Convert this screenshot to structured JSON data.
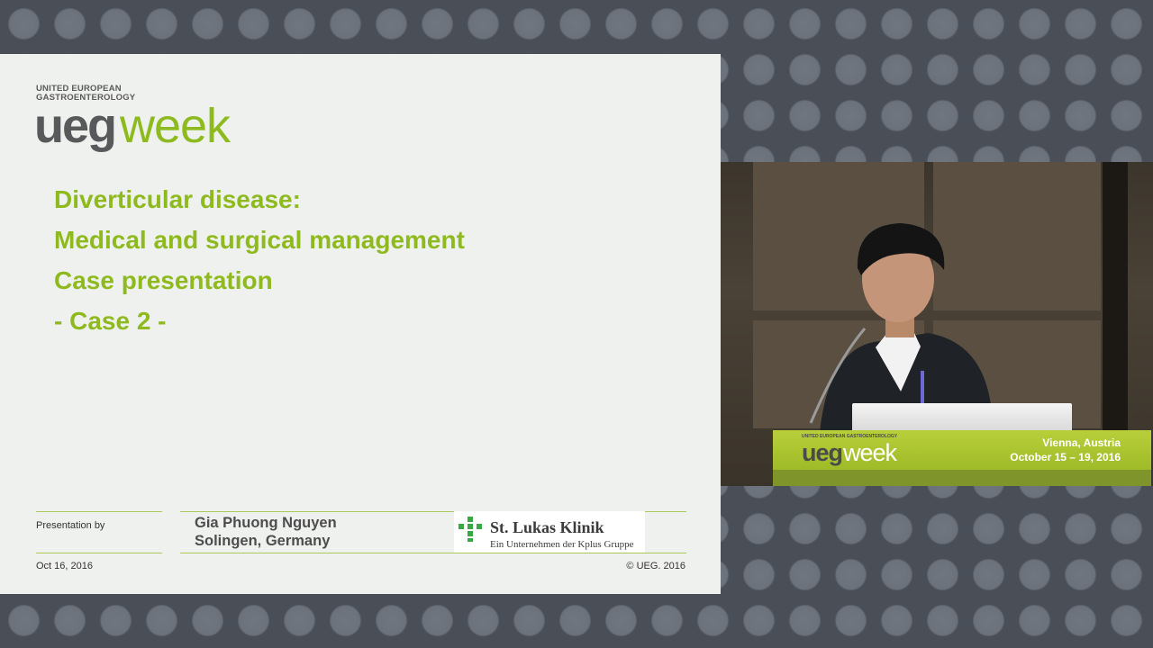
{
  "slide": {
    "logo": {
      "tagline_1": "UNITED EUROPEAN",
      "tagline_2": "GASTROENTEROLOGY",
      "word_ueg": "ueg",
      "word_week": "week"
    },
    "title_lines": [
      "Diverticular disease:",
      "Medical and surgical management",
      "Case presentation",
      "- Case 2 -"
    ],
    "footer": {
      "presentation_by": "Presentation by",
      "author_name": "Gia Phuong Nguyen",
      "author_location": "Solingen, Germany",
      "date": "Oct 16, 2016",
      "copyright": "© UEG. 2016",
      "clinic_name": "St. Lukas Klinik",
      "clinic_subtitle": "Ein Unternehmen der Kplus Gruppe"
    },
    "colors": {
      "accent_green": "#8fba1f",
      "slide_background": "#eff1ee"
    }
  },
  "video": {
    "podium_logo_tiny": "UNITED EUROPEAN GASTROENTEROLOGY",
    "podium_ueg": "ueg",
    "podium_week": "week",
    "location": "Vienna, Austria",
    "dates": "October 15 – 19, 2016"
  }
}
